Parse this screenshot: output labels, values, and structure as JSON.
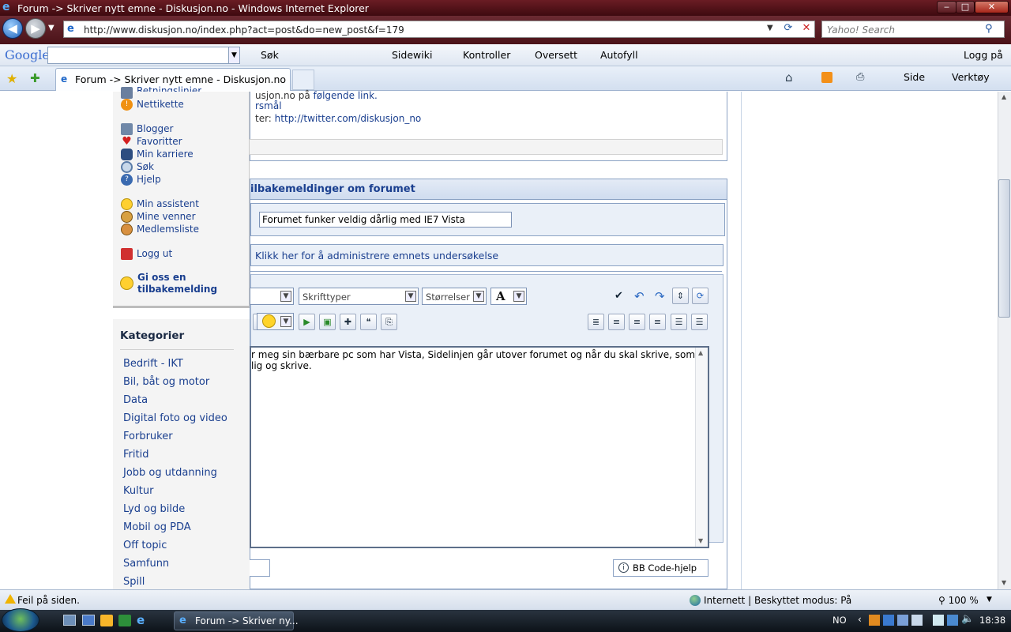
{
  "window": {
    "title": "Forum -> Skriver nytt emne - Diskusjon.no - Windows Internet Explorer",
    "minimize": "‒",
    "maximize": "□",
    "close": "✕"
  },
  "address_bar": {
    "url": "http://www.diskusjon.no/index.php?act=post&do=new_post&f=179",
    "search_placeholder": "Yahoo! Search"
  },
  "google_toolbar": {
    "logo": "Google",
    "items": [
      "Søk",
      "Sidewiki",
      "Kontroller",
      "Oversett",
      "Autofyll"
    ],
    "login": "Logg på"
  },
  "tab": {
    "title": "Forum -> Skriver nytt emne - Diskusjon.no"
  },
  "command_bar": {
    "side": "Side",
    "verktoy": "Verktøy"
  },
  "page_top": {
    "line1_pre": "usjon.no på ",
    "line1_link": "følgende link.",
    "line2": "rsmål",
    "line3_pre": "ter: ",
    "line3_link": "http://twitter.com/diskusjon_no"
  },
  "feedback_form": {
    "heading": "ilbakemeldinger om forumet",
    "subject_value": "Forumet funker veldig dårlig med IE7 Vista",
    "poll_link": "Klikk her for å administrere emnets undersøkelse",
    "font_select": "Skrifttyper",
    "size_select": "Størrelser",
    "color_select": "A",
    "editor_text_line1": "r meg sin bærbare pc som har Vista, Sidelinjen går utover forumet og når du skal skrive, som",
    "editor_text_line2": "lig og skrive.",
    "bb_code_help": "BB Code-hjelp"
  },
  "popup_menu": {
    "items": [
      {
        "label": "Retningslinjer",
        "icon": "document-icon"
      },
      {
        "label": "Nettikette",
        "icon": "exclamation-icon"
      },
      {
        "label": "Blogger",
        "icon": "blog-icon"
      },
      {
        "label": "Favoritter",
        "icon": "heart-icon"
      },
      {
        "label": "Min karriere",
        "icon": "footprints-icon"
      },
      {
        "label": "Søk",
        "icon": "magnifier-icon"
      },
      {
        "label": "Hjelp",
        "icon": "help-icon"
      },
      {
        "label": "Min assistent",
        "icon": "smiley-icon"
      },
      {
        "label": "Mine venner",
        "icon": "friends-icon"
      },
      {
        "label": "Medlemsliste",
        "icon": "members-icon"
      },
      {
        "label": "Logg ut",
        "icon": "logout-icon"
      }
    ],
    "feedback_label_line1": "Gi oss en",
    "feedback_label_line2": "tilbakemelding"
  },
  "categories": {
    "heading": "Kategorier",
    "items": [
      "Bedrift - IKT",
      "Bil, båt og motor",
      "Data",
      "Digital foto og video",
      "Forbruker",
      "Fritid",
      "Jobb og utdanning",
      "Kultur",
      "Lyd og bilde",
      "Mobil og PDA",
      "Off topic",
      "Samfunn",
      "Spill"
    ]
  },
  "status_bar": {
    "error_text": "Feil på siden.",
    "zone_text": "Internett | Beskyttet modus: På",
    "zoom": "100 %"
  },
  "taskbar": {
    "task_button": "Forum -> Skriver ny...",
    "language": "NO",
    "clock": "18:38"
  }
}
